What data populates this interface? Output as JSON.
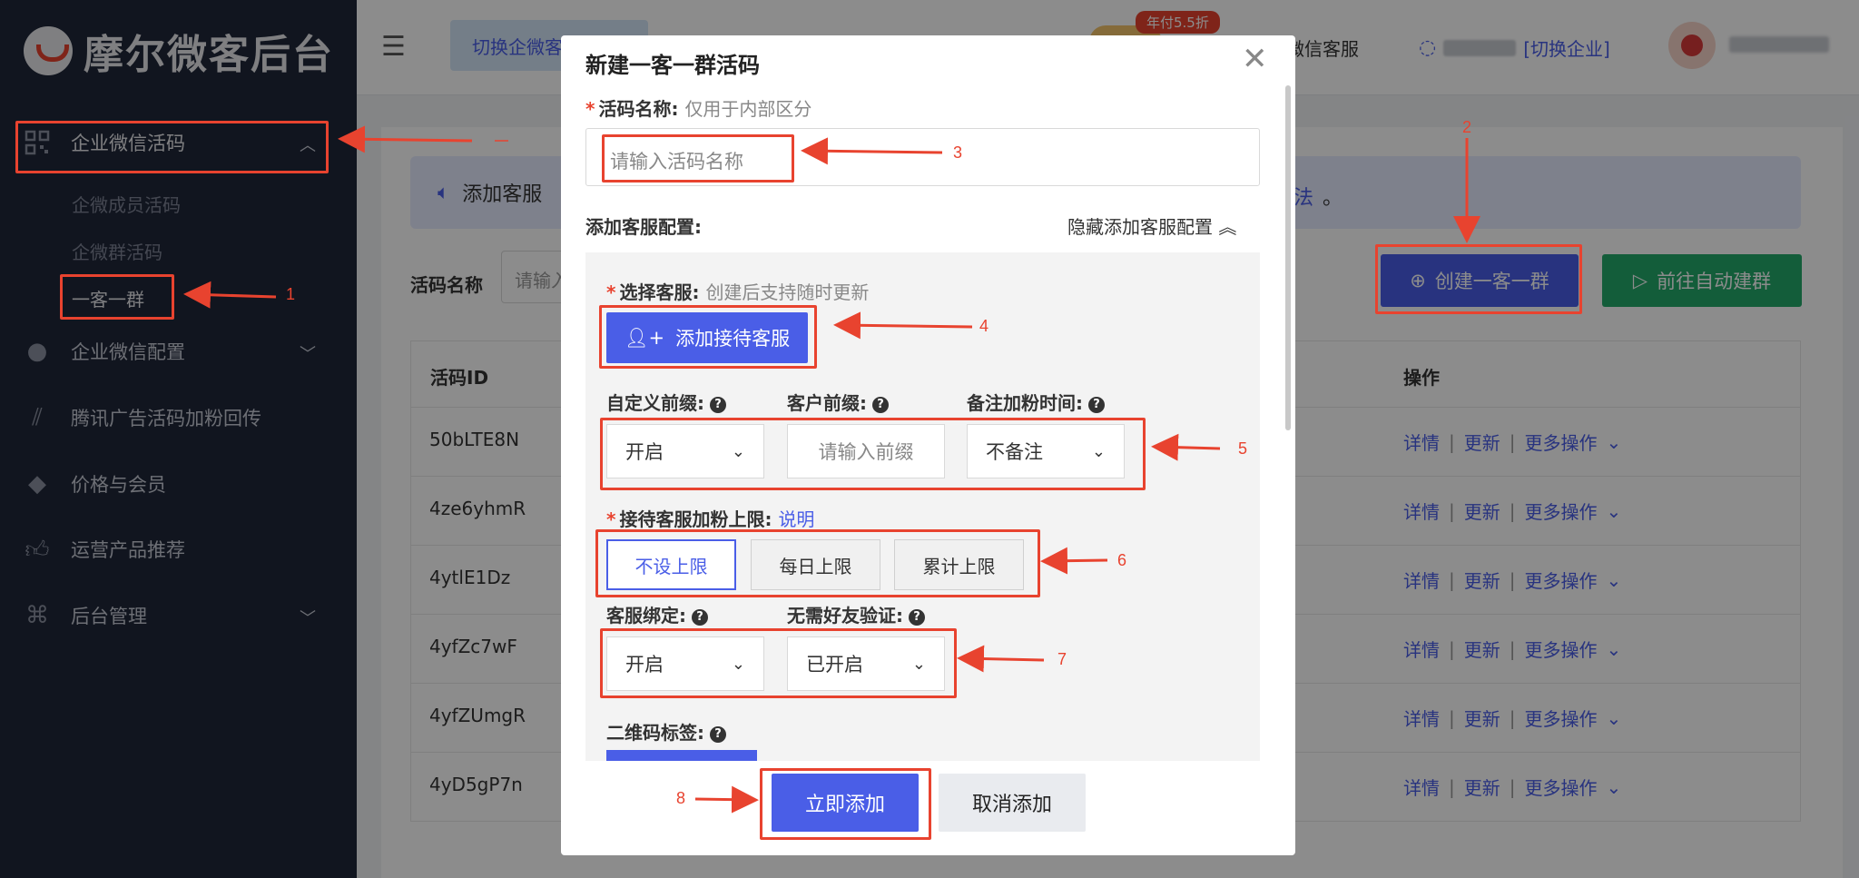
{
  "brand": {
    "title": "摩尔微客后台"
  },
  "sidebar": {
    "items": [
      {
        "label": "企业微信活码",
        "icon": "qrcode-icon"
      },
      {
        "label": "企业微信配置",
        "icon": "wechat-icon"
      },
      {
        "label": "腾讯广告活码加粉回传",
        "icon": "ad-icon"
      },
      {
        "label": "价格与会员",
        "icon": "diamond-icon"
      },
      {
        "label": "运营产品推荐",
        "icon": "thumbs-up-icon"
      },
      {
        "label": "后台管理",
        "icon": "command-icon"
      }
    ],
    "sub_items": [
      "企微成员活码",
      "企微群活码",
      "一客一群"
    ]
  },
  "topbar": {
    "tag": "切换企微客",
    "discount_badge": "年付5.5折",
    "wechat_service": "微信客服",
    "switch_enterprise": "[切换企业]"
  },
  "notice": {
    "text": "添加客服",
    "link": "法",
    "tail": "。"
  },
  "filter": {
    "label": "活码名称",
    "placeholder": "请输入"
  },
  "buttons": {
    "create": "创建一客一群",
    "auto": "前往自动建群"
  },
  "table": {
    "header_id": "活码ID",
    "header_op": "操作",
    "rows": [
      "50bLTE8N",
      "4ze6yhmR",
      "4ytlE1Dz",
      "4yfZc7wF",
      "4yfZUmgR",
      "4yD5gP7n"
    ],
    "ops": {
      "detail": "详情",
      "update": "更新",
      "more": "更多操作"
    }
  },
  "modal": {
    "title": "新建一客一群活码",
    "name_label": "活码名称:",
    "name_hint": "仅用于内部区分",
    "name_placeholder": "请输入活码名称",
    "config_label": "添加客服配置:",
    "hide_config": "隐藏添加客服配置",
    "select_cs_label": "选择客服:",
    "select_cs_hint": "创建后支持随时更新",
    "add_cs_button": "添加接待客服",
    "prefix_label": "自定义前缀:",
    "customer_prefix_label": "客户前缀:",
    "remark_time_label": "备注加粉时间:",
    "prefix_value": "开启",
    "customer_prefix_placeholder": "请输入前缀",
    "remark_value": "不备注",
    "limit_label": "接待客服加粉上限:",
    "limit_link": "说明",
    "limit_options": [
      "不设上限",
      "每日上限",
      "累计上限"
    ],
    "bind_label": "客服绑定:",
    "verify_label": "无需好友验证:",
    "bind_value": "开启",
    "verify_value": "已开启",
    "qr_tag_label": "二维码标签:",
    "submit": "立即添加",
    "cancel": "取消添加"
  },
  "annotations": [
    "1",
    "2",
    "3",
    "4",
    "5",
    "6",
    "7",
    "8"
  ],
  "colors": {
    "accent": "#4a5ee7",
    "annotation": "#e8432f",
    "sidebar": "#1f2739",
    "green": "#24a96b"
  }
}
